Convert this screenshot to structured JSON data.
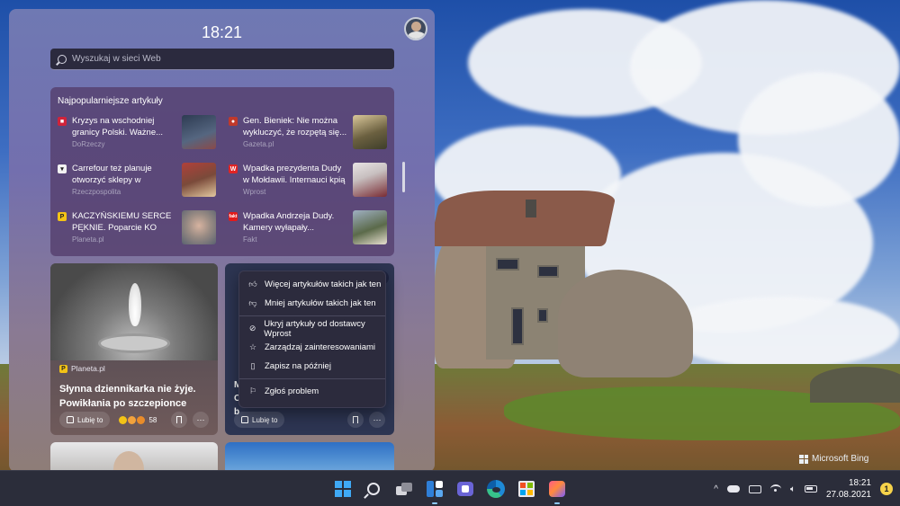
{
  "panel": {
    "clock": "18:21",
    "search_placeholder": "Wyszukaj w sieci Web"
  },
  "top_articles": {
    "heading": "Najpopularniejsze artykuły",
    "items": [
      {
        "title": "Kryzys na wschodniej granicy Polski. Ważne...",
        "source": "DoRzeczy",
        "logo": "DR",
        "logo_color": "#d0233a",
        "thumb_color": "#36445a"
      },
      {
        "title": "Gen. Bieniek: Nie można wykluczyć, że rozpętą się...",
        "source": "Gazeta.pl",
        "logo": "G",
        "logo_color": "#c0392b",
        "thumb_color": "#6b6040"
      },
      {
        "title": "Carrefour też planuje otworzyć sklepy w niedziele",
        "source": "Rzeczpospolita",
        "logo": "R",
        "logo_color": "#2c2c2c",
        "thumb_color": "#7a4a3a"
      },
      {
        "title": "Wpadka prezydenta Dudy w Mołdawii. Internauci kpią z...",
        "source": "Wprost",
        "logo": "W",
        "logo_color": "#e02424",
        "thumb_color": "#c8c0c0"
      },
      {
        "title": "KACZYŃSKIEMU SERCE PĘKNIE. Poparcie KO rośnie...",
        "source": "Planeta.pl",
        "logo": "P",
        "logo_color": "#f3c316",
        "thumb_color": "#9a8c84"
      },
      {
        "title": "Wpadka Andrzeja Dudy. Kamery wyłapały...",
        "source": "Fakt",
        "logo": "fakt",
        "logo_color": "#e21b1b",
        "thumb_color": "#5b6a4a"
      }
    ]
  },
  "card1": {
    "source": "Planeta.pl",
    "headline": "Słynna dziennikarka nie żyje. Powikłania po szczepionce",
    "like_label": "Lubię to",
    "reaction_count": "58"
  },
  "card2": {
    "partial_text": "M\nC\nb",
    "like_label": "Lubię to"
  },
  "context_menu": {
    "items": [
      {
        "label": "Więcej artykułów takich jak ten",
        "icon": "thumbs-up-icon"
      },
      {
        "label": "Mniej artykułów takich jak ten",
        "icon": "thumbs-down-icon"
      },
      {
        "label": "Ukryj artykuły od dostawcy Wprost",
        "icon": "hide-icon"
      },
      {
        "label": "Zarządzaj zainteresowaniami",
        "icon": "star-icon"
      },
      {
        "label": "Zapisz na później",
        "icon": "bookmark-icon"
      },
      {
        "label": "Zgłoś problem",
        "icon": "flag-icon"
      }
    ]
  },
  "wallpaper": {
    "watermark": "Microsoft Bing"
  },
  "taskbar": {
    "time": "18:21",
    "date": "27.08.2021",
    "notification_count": "1"
  }
}
